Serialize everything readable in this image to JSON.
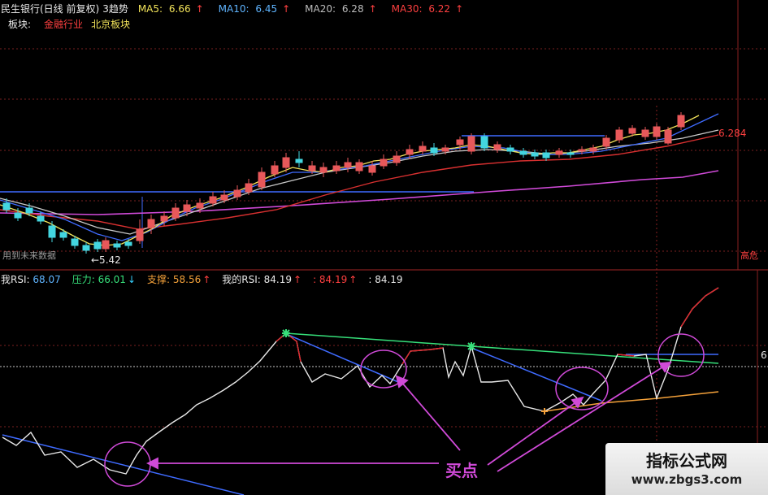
{
  "header": {
    "stock": "民生银行(日线 前复权)",
    "title": "3趋势",
    "ma": [
      {
        "label": "MA5:",
        "value": "6.66",
        "color": "#f2e35a"
      },
      {
        "label": "MA10:",
        "value": "6.45",
        "color": "#5fb4ff"
      },
      {
        "label": "MA20:",
        "value": "6.28",
        "color": "#bdbdbd"
      },
      {
        "label": "MA30:",
        "value": "6.22",
        "color": "#ff4040"
      }
    ],
    "arrow": "↑",
    "sector_label": "板块:",
    "sectors": [
      "金融行业",
      "北京板块"
    ]
  },
  "price_chart": {
    "low_label": "←5.42",
    "high_label": "6.284",
    "note": "用到未来数据",
    "right_edge_label": "高危"
  },
  "indicator": {
    "items": [
      {
        "label": "我RSI",
        "sep": ":",
        "value": "68.07",
        "color": "#5fb4ff",
        "arrow": ""
      },
      {
        "label": "压力",
        "sep": ":",
        "value": "66.01",
        "color": "#36e07a",
        "arrow": "↓"
      },
      {
        "label": "支撑",
        "sep": ":",
        "value": "58.56",
        "color": "#f4a13a",
        "arrow": "↑"
      },
      {
        "label": "我的RSI",
        "sep": ":",
        "value": "84.19",
        "color": "#e8e8e8",
        "arrow": "↑"
      },
      {
        "label": "",
        "sep": ":",
        "value": "84.19",
        "color": "#ff4040",
        "arrow": "↑"
      },
      {
        "label": "",
        "sep": ":",
        "value": "84.19",
        "color": "#e8e8e8",
        "arrow": ""
      }
    ],
    "annotation": "买点",
    "right_edge_label": "6"
  },
  "watermark": {
    "title": "指标公式网",
    "url": "www.zbgs3.com"
  },
  "colors": {
    "up": "#e8585a",
    "down": "#43d6e0",
    "ma5": "#f2e35a",
    "ma10": "#3f6bff",
    "ma20": "#c9c9c9",
    "ma30": "#d83030",
    "long_ma": "#d04ad8",
    "rsi": "#e8e8e8",
    "rsi_hot": "#e0252a",
    "pressure": "#36e07a",
    "support": "#f4a13a",
    "annotation": "#d04ad8"
  }
}
